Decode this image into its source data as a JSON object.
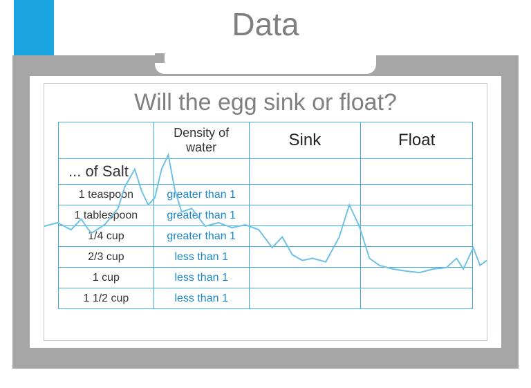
{
  "title": "Data",
  "subtitle": "Will the egg sink or float?",
  "headers": {
    "col1": "",
    "col2": "Density of water",
    "col3": "Sink",
    "col4": "Float"
  },
  "subheader": "... of Salt",
  "rows": [
    {
      "measure": "1 teaspoon",
      "density": "greater than 1"
    },
    {
      "measure": "1 tablespoon",
      "density": "greater than 1"
    },
    {
      "measure": "1/4 cup",
      "density": "greater than 1"
    },
    {
      "measure": "2/3 cup",
      "density": "less than 1"
    },
    {
      "measure": "1 cup",
      "density": "less than 1"
    },
    {
      "measure": "1 1/2 cup",
      "density": "less than 1"
    }
  ]
}
